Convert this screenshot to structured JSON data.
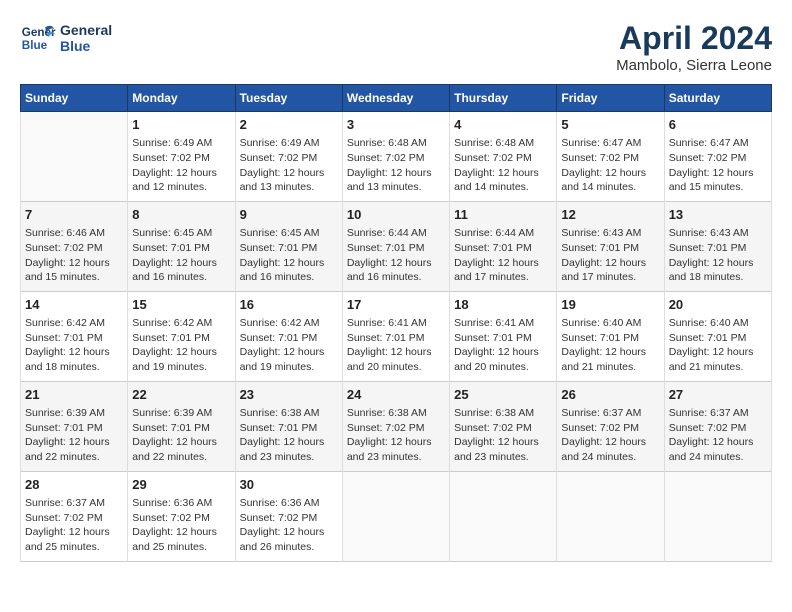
{
  "logo": {
    "line1": "General",
    "line2": "Blue"
  },
  "title": "April 2024",
  "subtitle": "Mambolo, Sierra Leone",
  "days_of_week": [
    "Sunday",
    "Monday",
    "Tuesday",
    "Wednesday",
    "Thursday",
    "Friday",
    "Saturday"
  ],
  "weeks": [
    [
      {
        "day": "",
        "info": ""
      },
      {
        "day": "1",
        "info": "Sunrise: 6:49 AM\nSunset: 7:02 PM\nDaylight: 12 hours\nand 12 minutes."
      },
      {
        "day": "2",
        "info": "Sunrise: 6:49 AM\nSunset: 7:02 PM\nDaylight: 12 hours\nand 13 minutes."
      },
      {
        "day": "3",
        "info": "Sunrise: 6:48 AM\nSunset: 7:02 PM\nDaylight: 12 hours\nand 13 minutes."
      },
      {
        "day": "4",
        "info": "Sunrise: 6:48 AM\nSunset: 7:02 PM\nDaylight: 12 hours\nand 14 minutes."
      },
      {
        "day": "5",
        "info": "Sunrise: 6:47 AM\nSunset: 7:02 PM\nDaylight: 12 hours\nand 14 minutes."
      },
      {
        "day": "6",
        "info": "Sunrise: 6:47 AM\nSunset: 7:02 PM\nDaylight: 12 hours\nand 15 minutes."
      }
    ],
    [
      {
        "day": "7",
        "info": "Sunrise: 6:46 AM\nSunset: 7:02 PM\nDaylight: 12 hours\nand 15 minutes."
      },
      {
        "day": "8",
        "info": "Sunrise: 6:45 AM\nSunset: 7:01 PM\nDaylight: 12 hours\nand 16 minutes."
      },
      {
        "day": "9",
        "info": "Sunrise: 6:45 AM\nSunset: 7:01 PM\nDaylight: 12 hours\nand 16 minutes."
      },
      {
        "day": "10",
        "info": "Sunrise: 6:44 AM\nSunset: 7:01 PM\nDaylight: 12 hours\nand 16 minutes."
      },
      {
        "day": "11",
        "info": "Sunrise: 6:44 AM\nSunset: 7:01 PM\nDaylight: 12 hours\nand 17 minutes."
      },
      {
        "day": "12",
        "info": "Sunrise: 6:43 AM\nSunset: 7:01 PM\nDaylight: 12 hours\nand 17 minutes."
      },
      {
        "day": "13",
        "info": "Sunrise: 6:43 AM\nSunset: 7:01 PM\nDaylight: 12 hours\nand 18 minutes."
      }
    ],
    [
      {
        "day": "14",
        "info": "Sunrise: 6:42 AM\nSunset: 7:01 PM\nDaylight: 12 hours\nand 18 minutes."
      },
      {
        "day": "15",
        "info": "Sunrise: 6:42 AM\nSunset: 7:01 PM\nDaylight: 12 hours\nand 19 minutes."
      },
      {
        "day": "16",
        "info": "Sunrise: 6:42 AM\nSunset: 7:01 PM\nDaylight: 12 hours\nand 19 minutes."
      },
      {
        "day": "17",
        "info": "Sunrise: 6:41 AM\nSunset: 7:01 PM\nDaylight: 12 hours\nand 20 minutes."
      },
      {
        "day": "18",
        "info": "Sunrise: 6:41 AM\nSunset: 7:01 PM\nDaylight: 12 hours\nand 20 minutes."
      },
      {
        "day": "19",
        "info": "Sunrise: 6:40 AM\nSunset: 7:01 PM\nDaylight: 12 hours\nand 21 minutes."
      },
      {
        "day": "20",
        "info": "Sunrise: 6:40 AM\nSunset: 7:01 PM\nDaylight: 12 hours\nand 21 minutes."
      }
    ],
    [
      {
        "day": "21",
        "info": "Sunrise: 6:39 AM\nSunset: 7:01 PM\nDaylight: 12 hours\nand 22 minutes."
      },
      {
        "day": "22",
        "info": "Sunrise: 6:39 AM\nSunset: 7:01 PM\nDaylight: 12 hours\nand 22 minutes."
      },
      {
        "day": "23",
        "info": "Sunrise: 6:38 AM\nSunset: 7:01 PM\nDaylight: 12 hours\nand 23 minutes."
      },
      {
        "day": "24",
        "info": "Sunrise: 6:38 AM\nSunset: 7:02 PM\nDaylight: 12 hours\nand 23 minutes."
      },
      {
        "day": "25",
        "info": "Sunrise: 6:38 AM\nSunset: 7:02 PM\nDaylight: 12 hours\nand 23 minutes."
      },
      {
        "day": "26",
        "info": "Sunrise: 6:37 AM\nSunset: 7:02 PM\nDaylight: 12 hours\nand 24 minutes."
      },
      {
        "day": "27",
        "info": "Sunrise: 6:37 AM\nSunset: 7:02 PM\nDaylight: 12 hours\nand 24 minutes."
      }
    ],
    [
      {
        "day": "28",
        "info": "Sunrise: 6:37 AM\nSunset: 7:02 PM\nDaylight: 12 hours\nand 25 minutes."
      },
      {
        "day": "29",
        "info": "Sunrise: 6:36 AM\nSunset: 7:02 PM\nDaylight: 12 hours\nand 25 minutes."
      },
      {
        "day": "30",
        "info": "Sunrise: 6:36 AM\nSunset: 7:02 PM\nDaylight: 12 hours\nand 26 minutes."
      },
      {
        "day": "",
        "info": ""
      },
      {
        "day": "",
        "info": ""
      },
      {
        "day": "",
        "info": ""
      },
      {
        "day": "",
        "info": ""
      }
    ]
  ]
}
